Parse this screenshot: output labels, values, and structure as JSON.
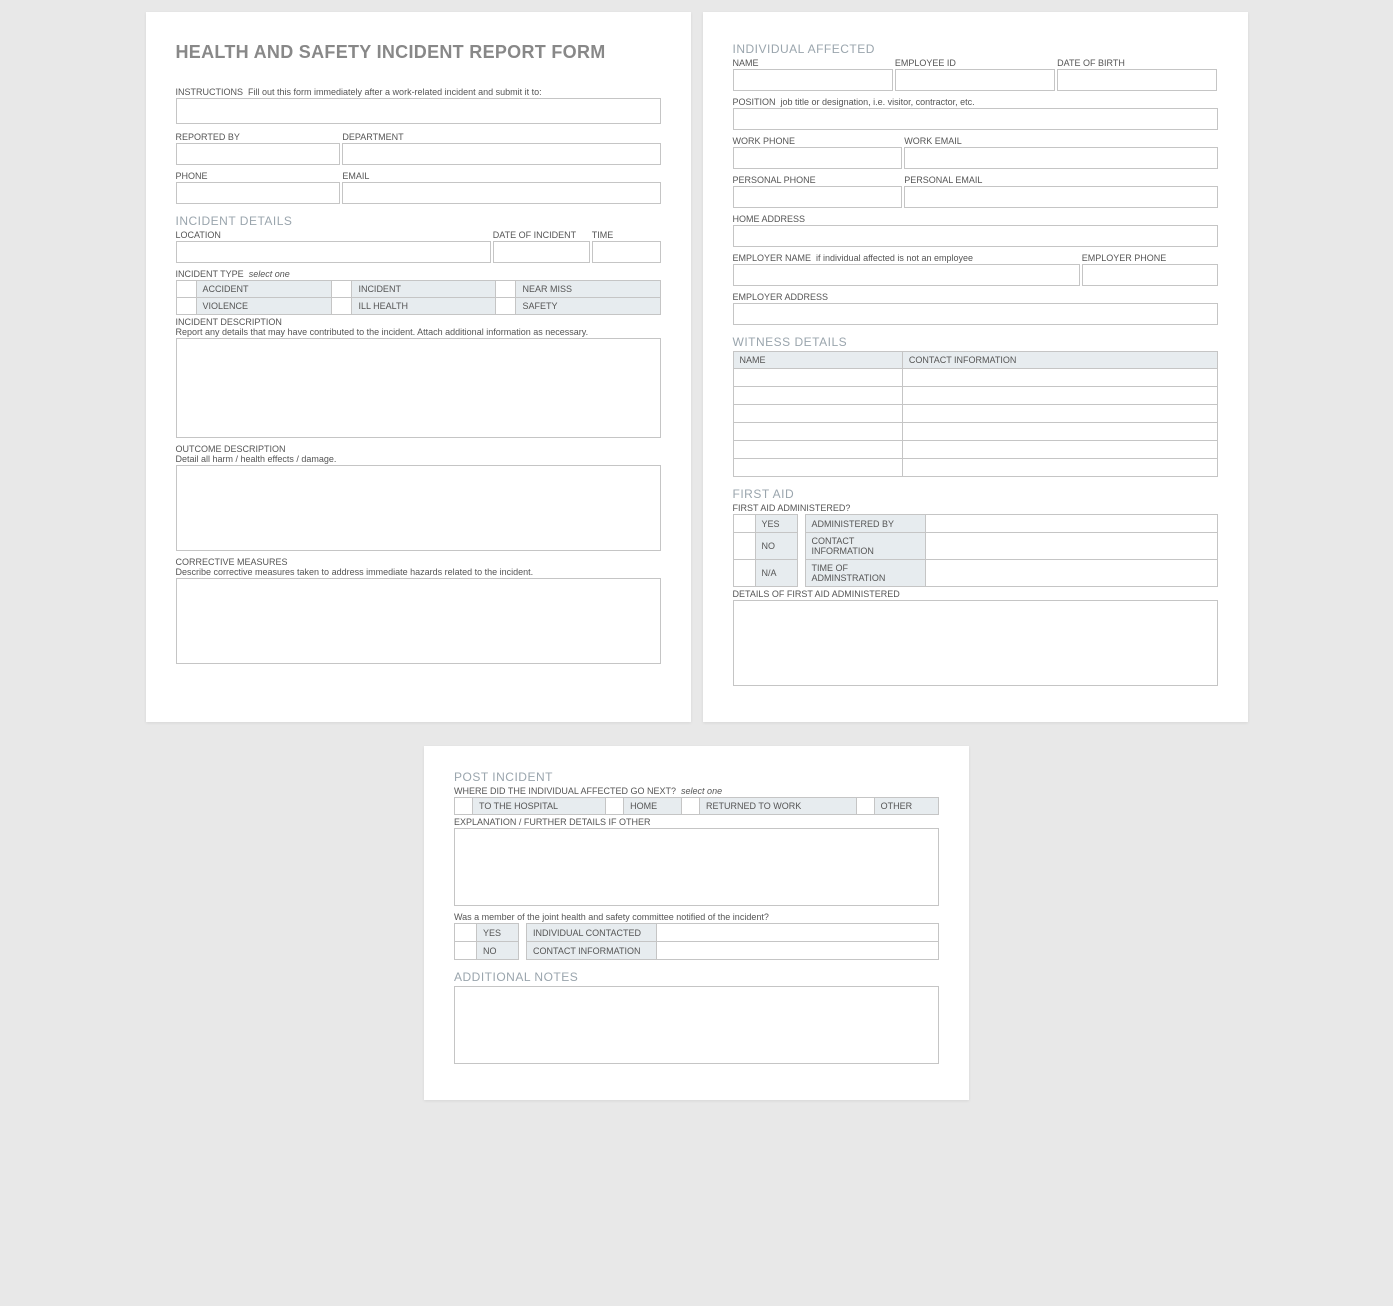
{
  "form_title": "HEALTH AND SAFETY INCIDENT REPORT FORM",
  "instructions": {
    "label": "INSTRUCTIONS",
    "text": "Fill out this form immediately after a work-related incident and submit it to:"
  },
  "reporter": {
    "reported_by": "REPORTED BY",
    "department": "DEPARTMENT",
    "phone": "PHONE",
    "email": "EMAIL"
  },
  "incident": {
    "section": "INCIDENT DETAILS",
    "location": "LOCATION",
    "date": "DATE OF INCIDENT",
    "time": "TIME",
    "type_label": "INCIDENT TYPE",
    "type_hint": "select one",
    "types": [
      "ACCIDENT",
      "INCIDENT",
      "NEAR MISS",
      "VIOLENCE",
      "ILL HEALTH",
      "SAFETY"
    ],
    "desc_label": "INCIDENT DESCRIPTION",
    "desc_sub": "Report any details that may have contributed to the incident.  Attach additional information as necessary.",
    "outcome_label": "OUTCOME DESCRIPTION",
    "outcome_sub": "Detail all harm / health effects / damage.",
    "corrective_label": "CORRECTIVE MEASURES",
    "corrective_sub": "Describe corrective measures taken to address immediate hazards related to the incident."
  },
  "individual": {
    "section": "INDIVIDUAL AFFECTED",
    "name": "NAME",
    "employee_id": "EMPLOYEE ID",
    "dob": "DATE OF BIRTH",
    "position_label": "POSITION",
    "position_hint": "job title or designation, i.e. visitor, contractor, etc.",
    "work_phone": "WORK PHONE",
    "work_email": "WORK EMAIL",
    "personal_phone": "PERSONAL PHONE",
    "personal_email": "PERSONAL EMAIL",
    "home_address": "HOME ADDRESS",
    "employer_name_label": "EMPLOYER NAME",
    "employer_name_hint": "if individual affected is not an employee",
    "employer_phone": "EMPLOYER PHONE",
    "employer_address": "EMPLOYER ADDRESS"
  },
  "witness": {
    "section": "WITNESS DETAILS",
    "col_name": "NAME",
    "col_contact": "CONTACT INFORMATION",
    "rows": 6
  },
  "first_aid": {
    "section": "FIRST AID",
    "q": "FIRST AID ADMINISTERED?",
    "options": [
      "YES",
      "NO",
      "N/A"
    ],
    "keys": [
      "ADMINISTERED BY",
      "CONTACT INFORMATION",
      "TIME OF ADMINSTRATION"
    ],
    "details_label": "DETAILS OF FIRST AID ADMINISTERED"
  },
  "post": {
    "section": "POST INCIDENT",
    "where_label": "WHERE DID THE INDIVIDUAL AFFECTED GO NEXT?",
    "where_hint": "select one",
    "where_options": [
      "TO THE HOSPITAL",
      "HOME",
      "RETURNED TO WORK",
      "OTHER"
    ],
    "explain_label": "EXPLANATION / FURTHER DETAILS IF OTHER",
    "committee_q": "Was a member of the joint health and safety committee notified of the incident?",
    "committee_options": [
      "YES",
      "NO"
    ],
    "committee_keys": [
      "INDIVIDUAL CONTACTED",
      "CONTACT INFORMATION"
    ]
  },
  "notes": {
    "section": "ADDITIONAL NOTES"
  }
}
